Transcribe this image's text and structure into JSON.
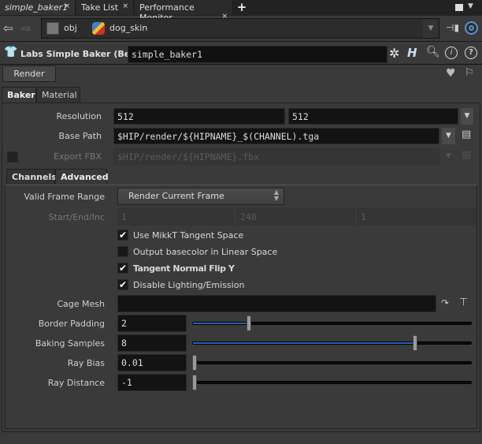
{
  "tabs": [
    {
      "label": "simple_baker1",
      "active": true
    },
    {
      "label": "Take List"
    },
    {
      "label": "Performance Monitor"
    }
  ],
  "nav": {
    "path": [
      {
        "label": "obj",
        "icon": "object-network-icon"
      },
      {
        "label": "dog_skin",
        "icon": "geometry-node-icon"
      }
    ]
  },
  "node": {
    "type_label": "Labs Simple Baker (Beta)",
    "name": "simple_baker1"
  },
  "render_label": "Render",
  "top_tabs": [
    "Baker",
    "Material"
  ],
  "params": {
    "resolution": {
      "label": "Resolution",
      "x": "512",
      "y": "512"
    },
    "base_path": {
      "label": "Base Path",
      "value": "$HIP/render/${HIPNAME}_$(CHANNEL).tga"
    },
    "export_fbx": {
      "label": "Export FBX",
      "value": "$HIP/render/${HIPNAME}.fbx",
      "checked": false
    }
  },
  "sub_tabs": [
    "Channels",
    "Advanced"
  ],
  "advanced": {
    "valid_frame_range": {
      "label": "Valid Frame Range",
      "value": "Render Current Frame"
    },
    "start_end_inc": {
      "label": "Start/End/Inc",
      "values": [
        "1",
        "240",
        "1"
      ]
    },
    "checkboxes": [
      {
        "label": "Use MikkT Tangent Space",
        "checked": true,
        "bold": false
      },
      {
        "label": "Output basecolor in Linear Space",
        "checked": false,
        "bold": false
      },
      {
        "label": "Tangent Normal Flip Y",
        "checked": true,
        "bold": true
      },
      {
        "label": "Disable Lighting/Emission",
        "checked": true,
        "bold": false
      }
    ],
    "cage_mesh": {
      "label": "Cage Mesh",
      "value": ""
    },
    "border_padding": {
      "label": "Border Padding",
      "value": "2",
      "slider_fraction": 0.2
    },
    "baking_samples": {
      "label": "Baking Samples",
      "value": "8",
      "slider_fraction": 0.8
    },
    "ray_bias": {
      "label": "Ray Bias",
      "value": "0.01",
      "slider_fraction": 0
    },
    "ray_distance": {
      "label": "Ray Distance",
      "value": "-1",
      "slider_fraction": 0
    }
  },
  "accent_color": "#2a63b8"
}
